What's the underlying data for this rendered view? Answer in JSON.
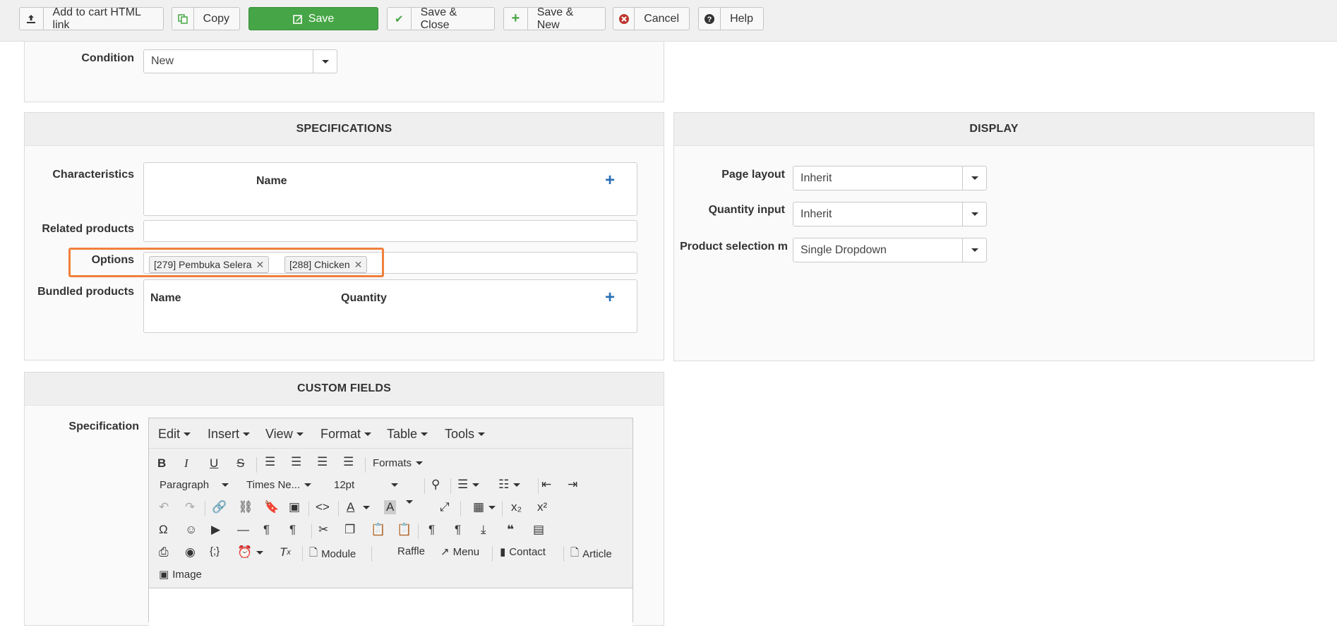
{
  "toolbar": {
    "add_to_cart_label": "Add to cart HTML link",
    "copy_label": "Copy",
    "save_label": "Save",
    "save_close_label": "Save & Close",
    "save_new_label": "Save & New",
    "cancel_label": "Cancel",
    "help_label": "Help"
  },
  "top_panel": {
    "condition_label": "Condition",
    "condition_value": "New"
  },
  "specifications": {
    "title": "SPECIFICATIONS",
    "characteristics_label": "Characteristics",
    "characteristics_col_name": "Name",
    "related_products_label": "Related products",
    "options_label": "Options",
    "options_tags": [
      "[279] Pembuka Selera",
      "[288] Chicken"
    ],
    "bundled_products_label": "Bundled products",
    "bundled_col_name": "Name",
    "bundled_col_quantity": "Quantity"
  },
  "display": {
    "title": "DISPLAY",
    "page_layout_label": "Page layout",
    "page_layout_value": "Inherit",
    "quantity_input_label": "Quantity input",
    "quantity_input_value": "Inherit",
    "product_selection_label": "Product selection m",
    "product_selection_value": "Single Dropdown"
  },
  "custom_fields": {
    "title": "CUSTOM FIELDS",
    "specification_label": "Specification"
  },
  "editor": {
    "menus": [
      "Edit",
      "Insert",
      "View",
      "Format",
      "Table",
      "Tools"
    ],
    "formats_label": "Formats",
    "paragraph_value": "Paragraph",
    "font_value": "Times Ne...",
    "size_value": "12pt",
    "module_label": "Module",
    "raffle_label": "Raffle",
    "menu_label": "Menu",
    "contact_label": "Contact",
    "article_label": "Article",
    "image_label": "Image"
  },
  "colors": {
    "save_green": "#46a546",
    "highlight_orange": "#f0803c",
    "plus_blue": "#2a6fb5",
    "cancel_red": "#bd362f"
  }
}
